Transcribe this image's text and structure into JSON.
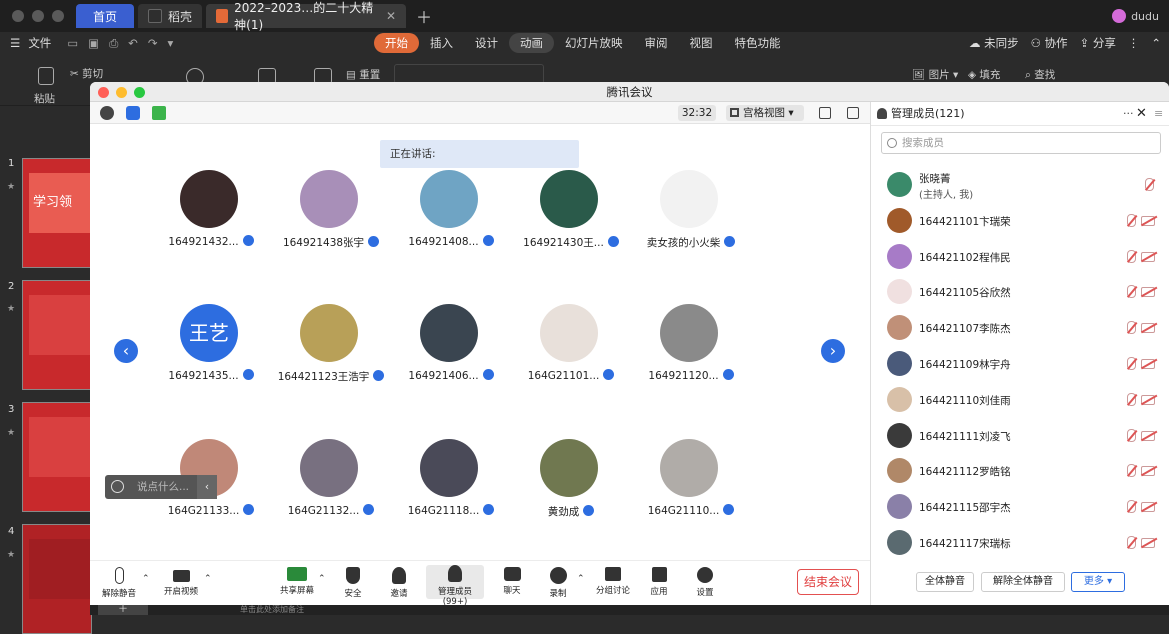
{
  "wps": {
    "tabs": {
      "home": "首页",
      "daoke": "稻壳",
      "doc": "2022–2023…的二十大精神(1)"
    },
    "user": "dudu",
    "menu": {
      "file": "文件",
      "ribbon_tabs": [
        "开始",
        "插入",
        "设计",
        "动画",
        "幻灯片放映",
        "审阅",
        "视图",
        "特色功能"
      ],
      "right": {
        "sync": "未同步",
        "collab": "协作",
        "share": "分享"
      }
    },
    "toolbar": {
      "paste": "粘贴",
      "cut": "剪切",
      "reset": "重置",
      "picture": "图片",
      "fill": "填充",
      "find": "查找"
    },
    "slides": [
      "1",
      "2",
      "3",
      "4"
    ],
    "slide1_title": "学习领",
    "add_slide_hint": "单击此处添加备注"
  },
  "meeting": {
    "window_title": "腾讯会议",
    "timer": "32:32",
    "view_mode": "宫格视图",
    "speaking_label": "正在讲话:",
    "participants": [
      {
        "name": "164921432...",
        "color": "#3a2a2a"
      },
      {
        "name": "164921438张宇",
        "color": "#a88fb8"
      },
      {
        "name": "164921408...",
        "color": "#6fa4c4"
      },
      {
        "name": "164921430王...",
        "color": "#2a5a4a"
      },
      {
        "name": "卖女孩的小火柴",
        "color": "#f2f2f2"
      },
      {
        "name": "164921435...",
        "color": "#2d6de0",
        "initials": "王艺"
      },
      {
        "name": "164421123王浩宇",
        "color": "#b8a058"
      },
      {
        "name": "164921406...",
        "color": "#3a4550"
      },
      {
        "name": "164G21101...",
        "color": "#e8e0da"
      },
      {
        "name": "164921120...",
        "color": "#8a8a8a"
      },
      {
        "name": "164G21133...",
        "color": "#c08878"
      },
      {
        "name": "164G21132...",
        "color": "#787080"
      },
      {
        "name": "164G21118...",
        "color": "#4a4a58"
      },
      {
        "name": "黄劲成",
        "color": "#707850"
      },
      {
        "name": "164G21110...",
        "color": "#b0aca8"
      }
    ],
    "chat_placeholder": "说点什么...",
    "bottom": {
      "unmute": "解除静音",
      "video": "开启视频",
      "share": "共享屏幕",
      "security": "安全",
      "invite": "邀请",
      "manage": "管理成员(99+)",
      "chat": "聊天",
      "record": "录制",
      "breakout": "分组讨论",
      "apps": "应用",
      "settings": "设置",
      "end": "结束会议"
    },
    "members_panel": {
      "title": "管理成员(121)",
      "search_placeholder": "搜索成员",
      "members": [
        {
          "name": "张晓菁",
          "sub": "(主持人, 我)",
          "color": "#3a8a6a"
        },
        {
          "name": "164421101卞瑞荣",
          "color": "#a05a2a"
        },
        {
          "name": "164421102程伟民",
          "color": "#a77bc7"
        },
        {
          "name": "164421105谷欣然",
          "color": "#f0e0e0"
        },
        {
          "name": "164421107李陈杰",
          "color": "#c09078"
        },
        {
          "name": "164421109林宇舟",
          "color": "#4a5a7a"
        },
        {
          "name": "164421110刘佳雨",
          "color": "#d8c0a8"
        },
        {
          "name": "164421111刘凌飞",
          "color": "#3a3a3a"
        },
        {
          "name": "164421112罗皓铭",
          "color": "#b08868"
        },
        {
          "name": "164421115邵宇杰",
          "color": "#8a80a8"
        },
        {
          "name": "164421117宋瑞标",
          "color": "#5a6a70"
        }
      ],
      "mute_all": "全体静音",
      "unmute_all": "解除全体静音",
      "more": "更多 ▾"
    }
  }
}
